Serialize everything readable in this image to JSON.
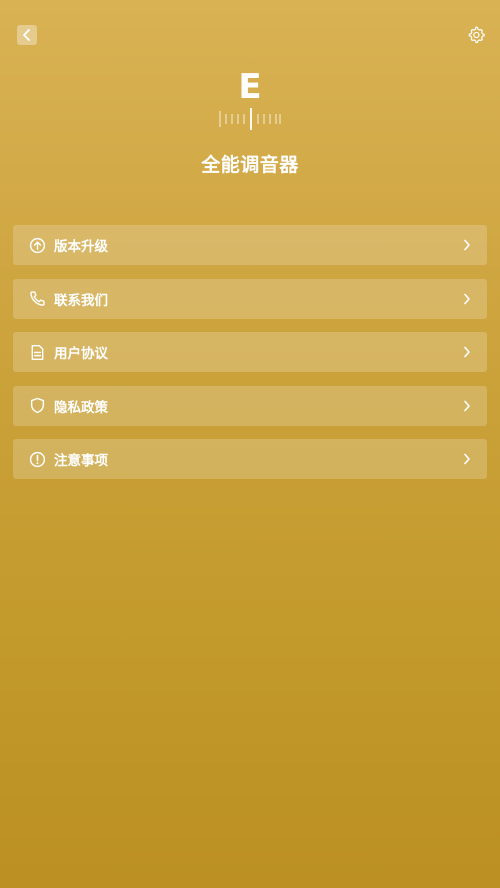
{
  "app": {
    "title": "全能调音器",
    "note_display": "E"
  },
  "icons": {
    "back": "chevron-left-icon",
    "settings": "gear-icon",
    "tuner_scale": "tuner-scale-icon"
  },
  "menu": {
    "items": [
      {
        "label": "版本升级",
        "icon": "upgrade-icon"
      },
      {
        "label": "联系我们",
        "icon": "phone-icon"
      },
      {
        "label": "用户协议",
        "icon": "document-icon"
      },
      {
        "label": "隐私政策",
        "icon": "shield-icon"
      },
      {
        "label": "注意事项",
        "icon": "alert-icon"
      }
    ]
  },
  "colors": {
    "background_top": "#d9b254",
    "background_bottom": "#bc9022",
    "text": "#ffffff"
  }
}
